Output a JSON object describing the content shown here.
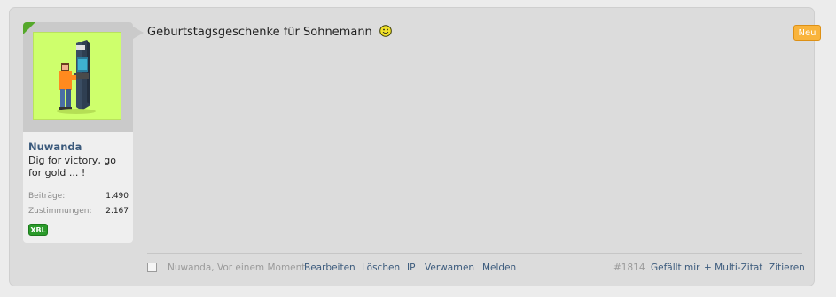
{
  "post": {
    "message": "Geburtstagsgeschenke für Sohnemann",
    "new_badge": "Neu",
    "post_number": "#1814"
  },
  "user": {
    "name": "Nuwanda",
    "title": "Dig for victory, go for gold ... !",
    "stats": {
      "posts_label": "Beiträge:",
      "posts_value": "1.490",
      "likes_label": "Zustimmungen:",
      "likes_value": "2.167"
    },
    "badge": "XBL"
  },
  "footer": {
    "meta": "Nuwanda, Vor einem Moment",
    "actions": {
      "edit": "Bearbeiten",
      "delete": "Löschen",
      "ip": "IP",
      "warn": "Verwarnen",
      "report": "Melden",
      "like": "Gefällt mir",
      "multiquote": "+ Multi-Zitat",
      "quote": "Zitieren"
    }
  },
  "colors": {
    "avatar_bg": "#ceff6c",
    "link": "#3b5a7c",
    "new_badge": "#f9b43c",
    "xbl_badge": "#2a9a2a"
  },
  "icons": [
    "smiley-icon",
    "arcade-avatar"
  ]
}
